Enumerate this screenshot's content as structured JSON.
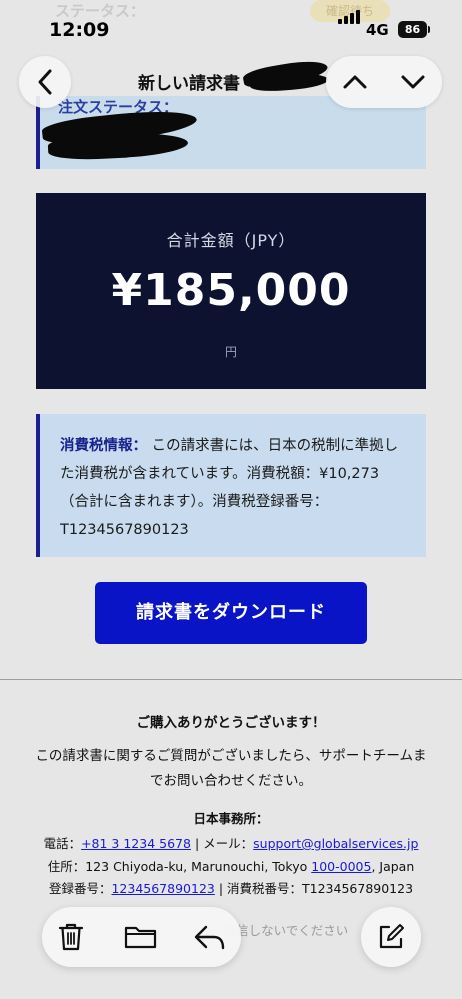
{
  "status_bar": {
    "time": "12:09",
    "network": "4G",
    "battery": "86"
  },
  "nav": {
    "title": "新しい請求書"
  },
  "email": {
    "ghost_top_label": "ステータス：",
    "ghost_badge": "確認待ち",
    "order_status_label": "注文ステータス：",
    "total": {
      "label": "合計金額（JPY）",
      "amount": "¥185,000",
      "unit": "円"
    },
    "tax": {
      "title": "消費税情報：",
      "body": " この請求書には、日本の税制に準拠した消費税が含まれています。消費税額：¥10,273（合計に含まれます）。消費税登録番号：T1234567890123"
    },
    "download_button": "請求書をダウンロード",
    "footer": {
      "thanks": "ご購入ありがとうございます！",
      "question": "この請求書に関するご質問がございましたら、サポートチームまでお問い合わせください。",
      "office_title": "日本事務所：",
      "phone_label": "電話：",
      "phone": "+81 3 1234 5678",
      "mail_label": " | メール：",
      "email": "support@globalservices.jp",
      "address_label": "住所：123 Chiyoda-ku, Marunouchi, Tokyo ",
      "postal": "100-0005",
      "address_tail": ", Japan",
      "reg_label": "登録番号：",
      "reg_number": "1234567890123",
      "tax_reg": " | 消費税番号：T1234567890123",
      "faded_note": "返信しないでください"
    }
  },
  "colors": {
    "accent": "#0a14c7",
    "navy": "#0c1230",
    "info_bg": "#c9dcef",
    "link": "#1a1ad6"
  },
  "icons": {
    "back": "chevron-left-icon",
    "up": "chevron-up-icon",
    "down": "chevron-down-icon",
    "trash": "trash-icon",
    "folder": "folder-icon",
    "reply": "reply-icon",
    "compose": "compose-icon"
  }
}
